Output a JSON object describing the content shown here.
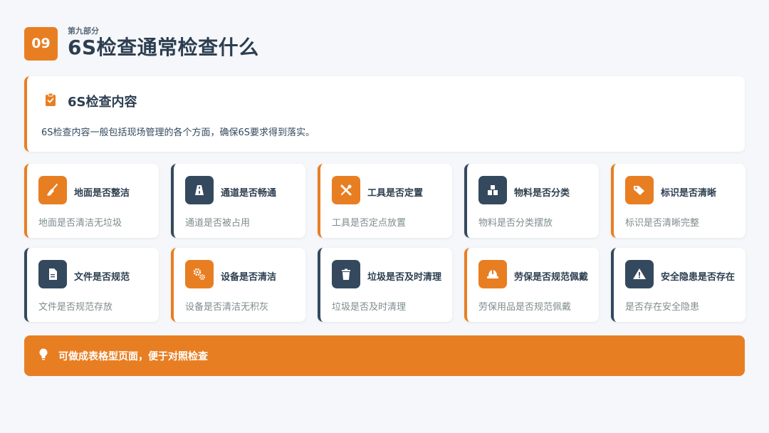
{
  "header": {
    "number": "09",
    "subtitle": "第九部分",
    "title": "6S检查通常检查什么"
  },
  "intro": {
    "icon": "clipboard-check-icon",
    "title": "6S检查内容",
    "description": "6S检查内容一般包括现场管理的各个方面，确保6S要求得到落实。"
  },
  "items": [
    {
      "title": "地面是否整洁",
      "desc": "地面是否清洁无垃圾",
      "icon": "broom-icon",
      "theme": "orange"
    },
    {
      "title": "通道是否畅通",
      "desc": "通道是否被占用",
      "icon": "road-icon",
      "theme": "dark"
    },
    {
      "title": "工具是否定置",
      "desc": "工具是否定点放置",
      "icon": "tools-icon",
      "theme": "orange"
    },
    {
      "title": "物料是否分类",
      "desc": "物料是否分类摆放",
      "icon": "boxes-icon",
      "theme": "dark"
    },
    {
      "title": "标识是否清晰",
      "desc": "标识是否清晰完整",
      "icon": "tags-icon",
      "theme": "orange"
    },
    {
      "title": "文件是否规范",
      "desc": "文件是否规范存放",
      "icon": "file-icon",
      "theme": "dark"
    },
    {
      "title": "设备是否清洁",
      "desc": "设备是否清洁无积灰",
      "icon": "gears-icon",
      "theme": "orange"
    },
    {
      "title": "垃圾是否及时清理",
      "desc": "垃圾是否及时清理",
      "icon": "trash-icon",
      "theme": "dark"
    },
    {
      "title": "劳保是否规范佩戴",
      "desc": "劳保用品是否规范佩戴",
      "icon": "hard-hat-icon",
      "theme": "orange"
    },
    {
      "title": "安全隐患是否存在",
      "desc": "是否存在安全隐患",
      "icon": "warning-icon",
      "theme": "dark"
    }
  ],
  "tip": {
    "icon": "lightbulb-icon",
    "text": "可做成表格型页面，便于对照检查"
  },
  "colors": {
    "accent": "#e87e22",
    "dark": "#34495e",
    "background": "#f5f7fa"
  }
}
